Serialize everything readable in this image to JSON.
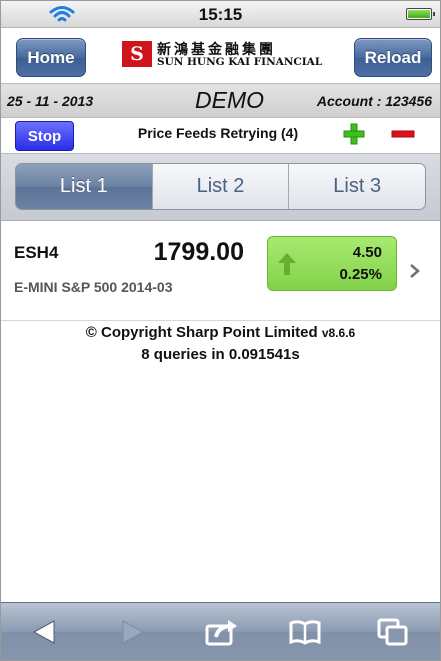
{
  "status_bar": {
    "time": "15:15",
    "wifi_icon": "wifi-icon",
    "battery_icon": "battery-icon"
  },
  "header": {
    "home_label": "Home",
    "reload_label": "Reload",
    "logo": {
      "mark": "S",
      "chinese": "新鴻基金融集團",
      "english": "SUN HUNG KAI FINANCIAL"
    }
  },
  "info_bar": {
    "date": "25 - 11 - 2013",
    "mode": "DEMO",
    "account": "Account : 123456"
  },
  "feed_bar": {
    "stop_label": "Stop",
    "status": "Price Feeds Retrying (4)",
    "add_icon": "plus-icon",
    "remove_icon": "minus-icon"
  },
  "tabs": [
    {
      "label": "List 1",
      "active": true
    },
    {
      "label": "List 2",
      "active": false
    },
    {
      "label": "List 3",
      "active": false
    }
  ],
  "quotes": [
    {
      "symbol": "ESH4",
      "description": "E-MINI S&P 500 2014-03",
      "price": "1799.00",
      "change": "4.50",
      "change_pct": "0.25%",
      "direction": "up",
      "up_color": "#82d24a"
    }
  ],
  "footer": {
    "copyright": "© Copyright Sharp Point Limited",
    "version": "v8.6.6",
    "queries": "8 queries in 0.091541s"
  },
  "toolbar": {
    "icons": [
      "back-icon",
      "forward-icon",
      "share-icon",
      "bookmarks-icon",
      "pages-icon"
    ]
  }
}
